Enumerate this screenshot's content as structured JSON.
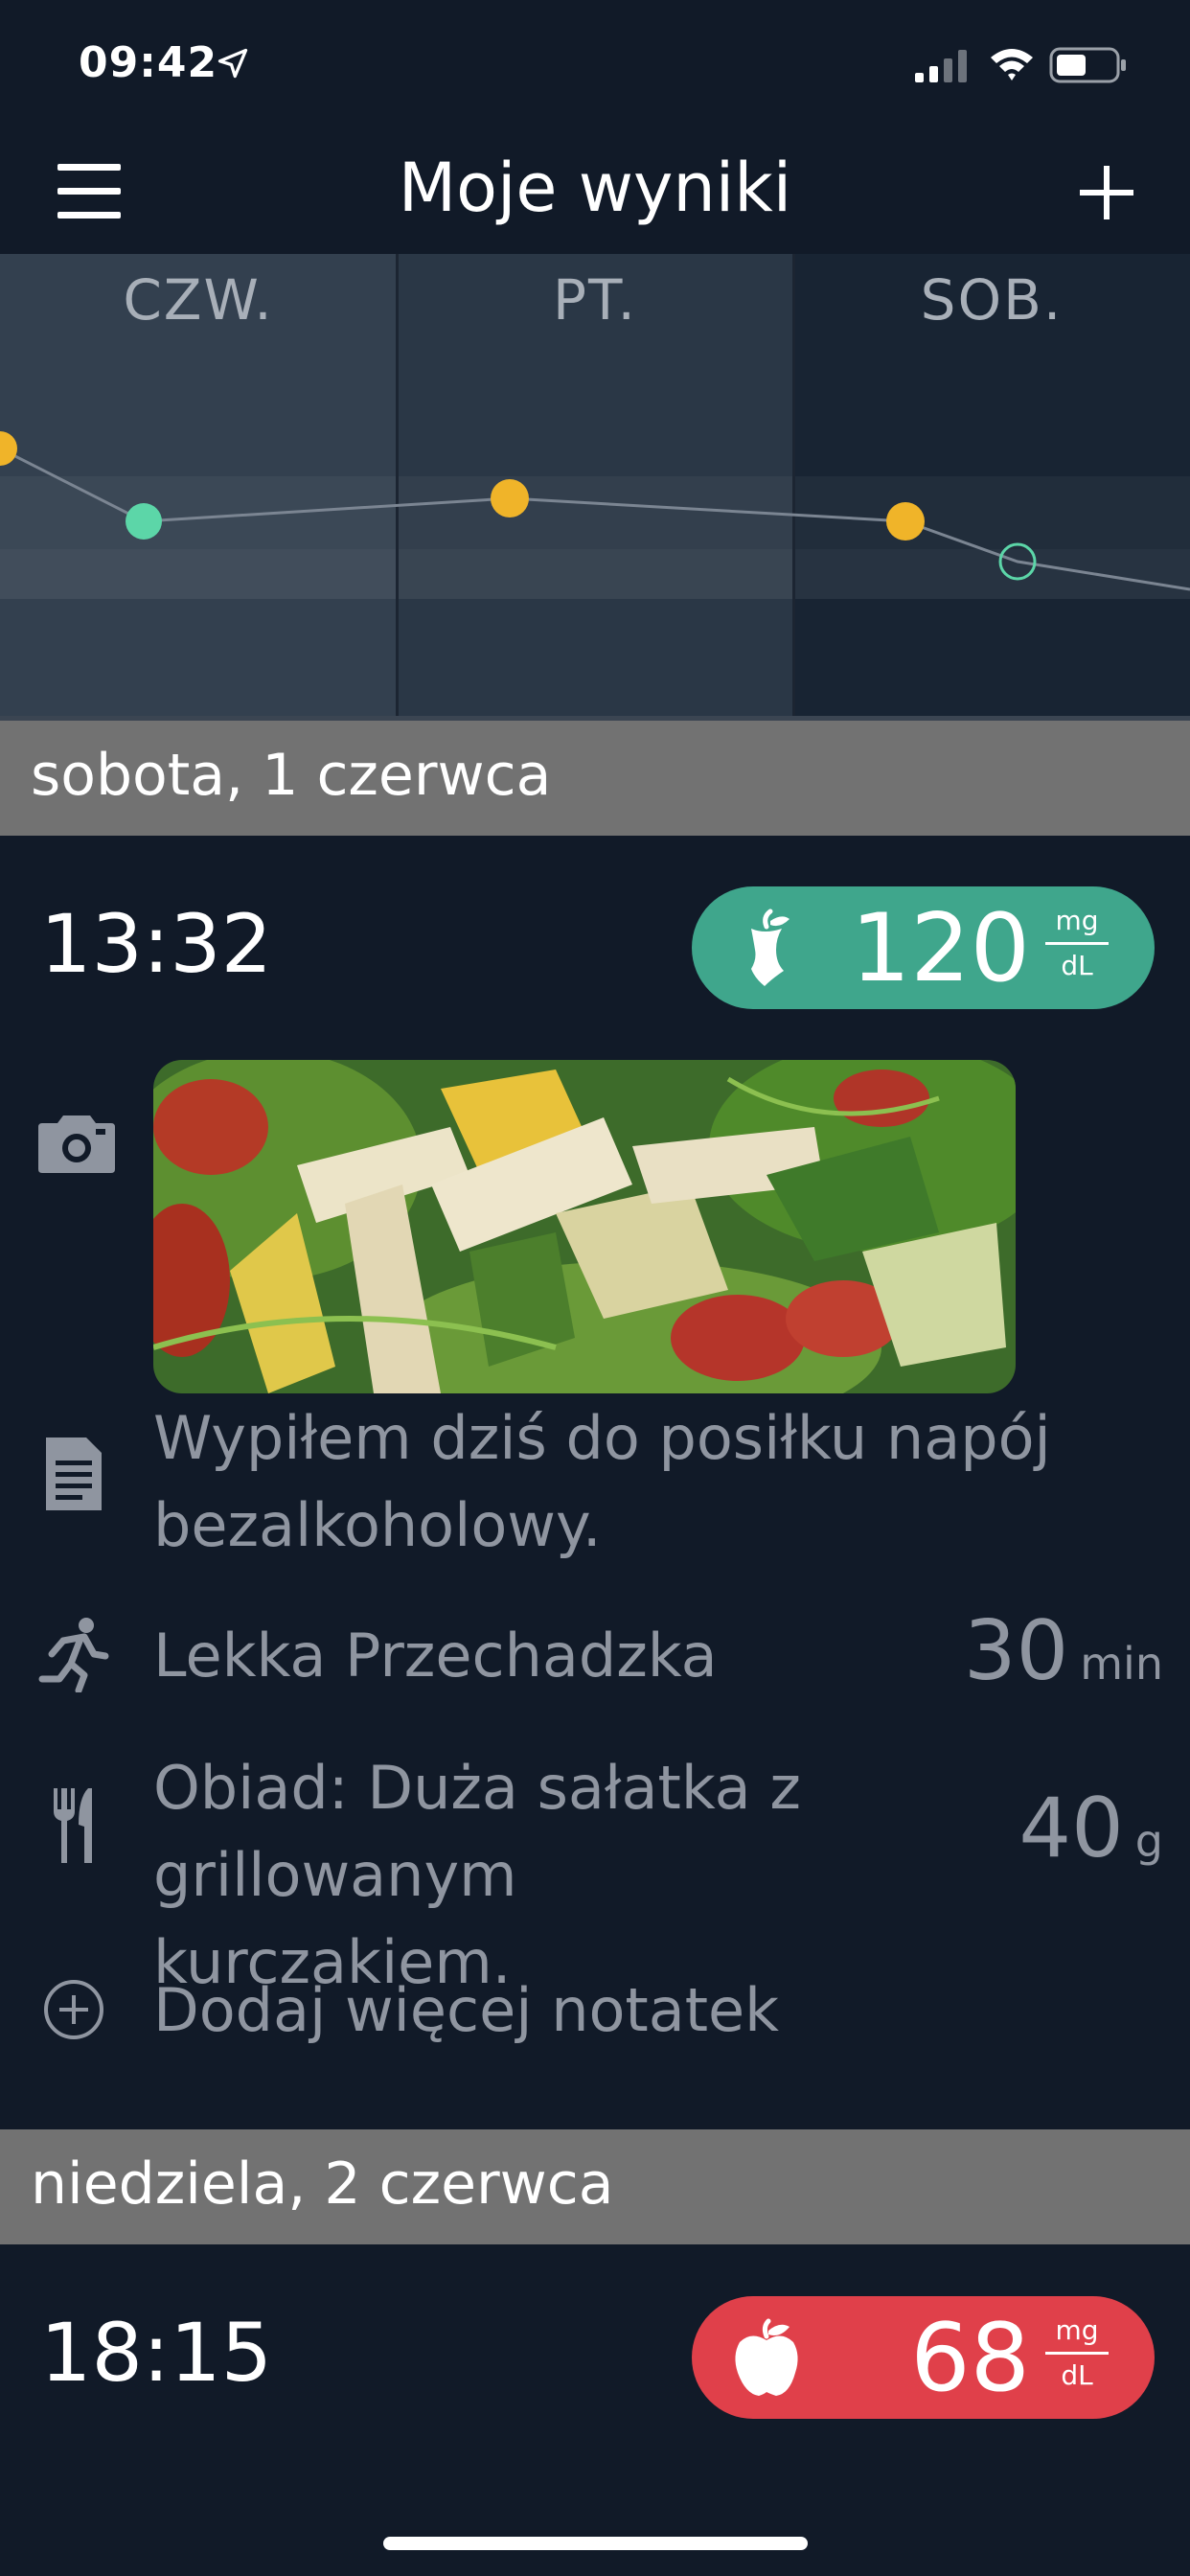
{
  "status_bar": {
    "time": "09:42"
  },
  "nav": {
    "title": "Moje wyniki"
  },
  "chart_data": {
    "type": "scatter",
    "x_categories": [
      "CZW.",
      "PT.",
      "SOB."
    ],
    "points_color": {
      "high": "#f0b429",
      "normal": "#5cd6a8"
    },
    "grid": false
  },
  "entries": [
    {
      "date_header": "sobota, 1 czerwca",
      "time": "13:32",
      "reading": {
        "value": "120",
        "unit_top": "mg",
        "unit_bottom": "dL",
        "color": "#3fa68c",
        "icon": "bitten-apple-icon"
      },
      "note": "Wypiłem dziś do posiłku napój bezalkoholowy.",
      "activity": {
        "label": "Lekka Przechadzka",
        "value": "30",
        "unit": "min"
      },
      "meal": {
        "label": "Obiad: Duża sałatka z grillowanym kurczakiem.",
        "value": "40",
        "unit": "g"
      },
      "add_notes": "Dodaj więcej notatek"
    },
    {
      "date_header": "niedziela, 2 czerwca",
      "time": "18:15",
      "reading": {
        "value": "68",
        "unit_top": "mg",
        "unit_bottom": "dL",
        "color": "#e0404a",
        "icon": "apple-icon"
      }
    }
  ]
}
